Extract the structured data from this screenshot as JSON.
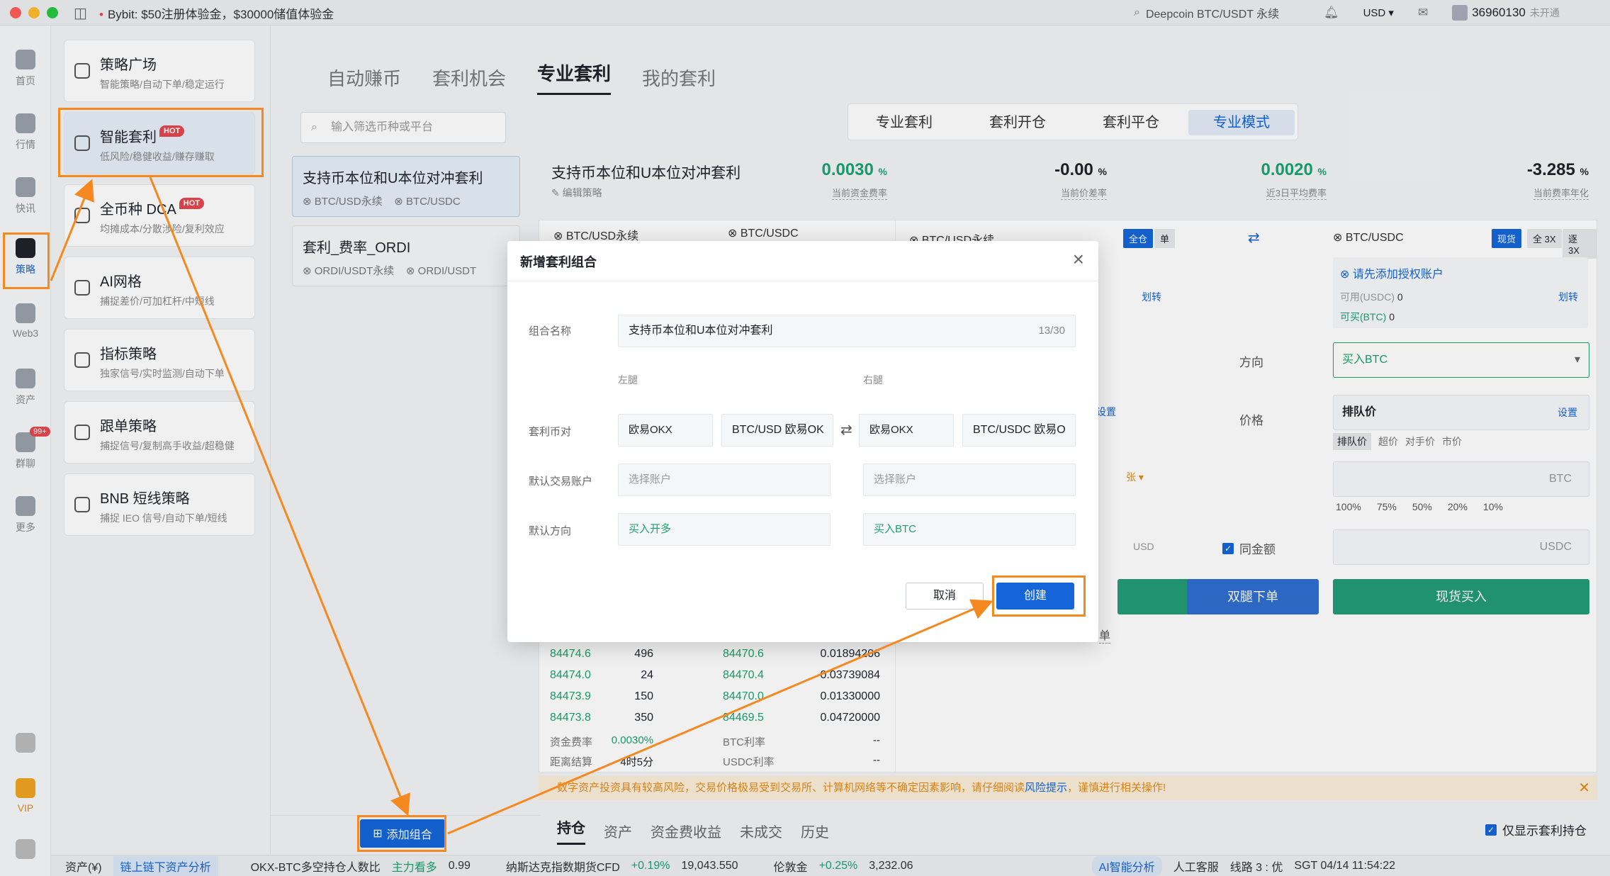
{
  "window": {
    "notice": "Bybit: $50注册体验金，$30000储值体验金",
    "search_placeholder": "Deepcoin BTC/USDT 永续",
    "currency": "USD ▾",
    "account_id": "36960130",
    "account_status": "未开通"
  },
  "rail": [
    {
      "label": "首页",
      "icon": "home-icon"
    },
    {
      "label": "行情",
      "icon": "chart-icon"
    },
    {
      "label": "快讯",
      "icon": "news-icon"
    },
    {
      "label": "策略",
      "icon": "robot-icon"
    },
    {
      "label": "Web3",
      "icon": "web3-icon"
    },
    {
      "label": "资产",
      "icon": "wallet-icon"
    },
    {
      "label": "群聊",
      "icon": "chat-icon",
      "badge": "99+"
    },
    {
      "label": "更多",
      "icon": "more-icon"
    },
    {
      "label": "VIP",
      "icon": "vip-icon"
    }
  ],
  "strategies": [
    {
      "title": "策略广场",
      "desc": "智能策略/自动下单/稳定运行"
    },
    {
      "title": "智能套利",
      "desc": "低风险/稳健收益/赚存赚取",
      "hot": "HOT"
    },
    {
      "title": "全币种 DCA",
      "desc": "均摊成本/分散涉险/复利效应",
      "hot": "HOT"
    },
    {
      "title": "AI网格",
      "desc": "捕捉差价/可加杠杆/中短线"
    },
    {
      "title": "指标策略",
      "desc": "独家信号/实时监测/自动下单"
    },
    {
      "title": "跟单策略",
      "desc": "捕捉信号/复制高手收益/超稳健"
    },
    {
      "title": "BNB 短线策略",
      "desc": "捕捉 IEO 信号/自动下单/短线"
    }
  ],
  "tabs": [
    "自动赚币",
    "套利机会",
    "专业套利",
    "我的套利"
  ],
  "filter_placeholder": "输入筛选币种或平台",
  "combos": [
    {
      "title": "支持币本位和U本位对冲套利",
      "legs": [
        "BTC/USD永续",
        "BTC/USDC"
      ]
    },
    {
      "title": "套利_费率_ORDI",
      "legs": [
        "ORDI/USDT永续",
        "ORDI/USDT"
      ]
    }
  ],
  "add_combo": "添加组合",
  "mode_tabs": [
    "专业套利",
    "套利开仓",
    "套利平仓",
    "专业模式"
  ],
  "combo_header": {
    "title": "支持币本位和U本位对冲套利",
    "edit": "编辑策略"
  },
  "metrics": [
    {
      "value": "0.0030",
      "unit": "%",
      "label": "当前资金费率",
      "color": "#1aa36f"
    },
    {
      "value": "-0.00",
      "unit": "%",
      "label": "当前价差率",
      "color": "#1f2329"
    },
    {
      "value": "0.0020",
      "unit": "%",
      "label": "近3日平均费率",
      "color": "#1aa36f"
    },
    {
      "value": "-3.285",
      "unit": "%",
      "label": "当前费率年化",
      "color": "#1f2329"
    }
  ],
  "panel": {
    "left_pair": "BTC/USD永续",
    "right_pair_top": "BTC/USDC",
    "mid_left_pair": "BTC/USD永续",
    "btn_all": "全仓",
    "btn_single": "单",
    "right_pair": "BTC/USDC",
    "spot": "现货",
    "lev1": "全 3X",
    "lev2": "逐 3X",
    "add_auth": "请先添加授权账户",
    "transfer": "划转",
    "available": "可用(USDC)",
    "available_val": "0",
    "buyable": "可买(BTC)",
    "buyable_val": "0",
    "direction_label": "方向",
    "direction_value": "买入BTC",
    "price_label": "价格",
    "queue_price": "排队价",
    "settings": "设置",
    "price_opts": [
      "排队价",
      "超价",
      "对手价",
      "市价"
    ],
    "unit_btc": "BTC",
    "unit_usd": "USD",
    "unit_usdc": "USDC",
    "unit_zhang": "张 ▾",
    "pcts": [
      "100%",
      "75%",
      "50%",
      "20%",
      "10%"
    ],
    "same_amount": "同金额",
    "btn_both": "双腿下单",
    "btn_spot_buy": "现货买入",
    "order_frag": "单"
  },
  "orderbook": [
    [
      "84474.6",
      "496",
      "84470.6",
      "0.01894206"
    ],
    [
      "84474.0",
      "24",
      "84470.4",
      "0.03739084"
    ],
    [
      "84473.9",
      "150",
      "84470.0",
      "0.01330000"
    ],
    [
      "84473.8",
      "350",
      "84469.5",
      "0.04720000"
    ]
  ],
  "fund_rows": [
    {
      "l": "资金费率",
      "v": "0.0030%",
      "l2": "BTC利率",
      "v2": "--"
    },
    {
      "l": "距离结算",
      "v": "4时5分",
      "l2": "USDC利率",
      "v2": "--"
    }
  ],
  "warning": {
    "text": "数字资产投资具有较高风险，交易价格极易受到交易所、计算机网络等不确定因素影响，请仔细阅读",
    "link": "风险提示",
    "tail": "，谨慎进行相关操作!"
  },
  "bottom_tabs": [
    "持仓",
    "资产",
    "资金费收益",
    "未成交",
    "历史"
  ],
  "only_show": "仅显示套利持仓",
  "status": {
    "assets": "资产(¥)",
    "analysis": "链上链下资产分析",
    "ratio_label": "OKX-BTC多空持仓人数比",
    "ratio_tag": "主力看多",
    "ratio_val": "0.99",
    "nasdaq": "纳斯达克指数期货CFD",
    "nasdaq_chg": "+0.19%",
    "nasdaq_val": "19,043.550",
    "gold": "伦敦金",
    "gold_chg": "+0.25%",
    "gold_val": "3,232.06",
    "ai": "AI智能分析",
    "service": "人工客服",
    "line": "线路 3 : 优",
    "time": "SGT 04/14 11:54:22"
  },
  "modal": {
    "title": "新增套利组合",
    "name_label": "组合名称",
    "name_value": "支持币本位和U本位对冲套利",
    "name_count": "13/30",
    "left_leg": "左腿",
    "right_leg": "右腿",
    "pair_label": "套利币对",
    "left_exchange": "欧易OKX",
    "left_pair": "BTC/USD 欧易OK",
    "right_exchange": "欧易OKX",
    "right_pair": "BTC/USDC 欧易O",
    "account_label": "默认交易账户",
    "account_ph": "选择账户",
    "direction_label": "默认方向",
    "left_dir": "买入开多",
    "right_dir": "买入BTC",
    "cancel": "取消",
    "create": "创建"
  },
  "colors": {
    "accent": "#1565d8",
    "green": "#1aa36f",
    "orange": "#f5891f",
    "red": "#e5484d"
  }
}
